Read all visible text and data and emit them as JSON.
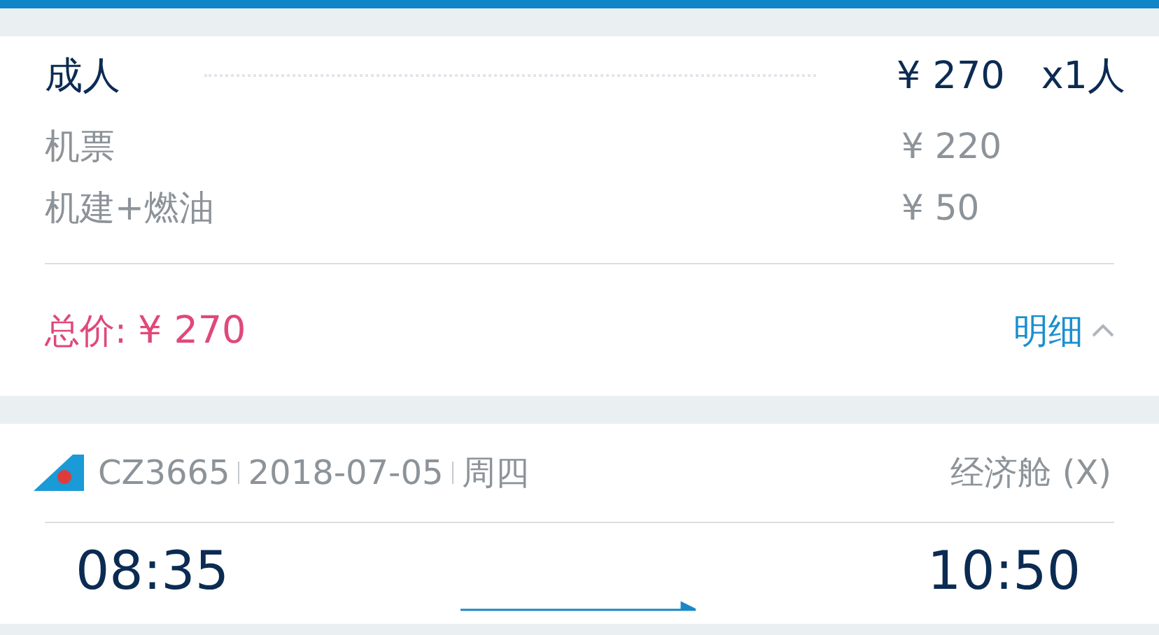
{
  "passenger": {
    "type": "成人",
    "price": "¥ 270",
    "count": "x1人"
  },
  "breakdown": [
    {
      "label": "机票",
      "price": "¥ 220"
    },
    {
      "label": "机建+燃油",
      "price": "¥ 50"
    }
  ],
  "total": {
    "label": "总价:",
    "amount": "¥ 270",
    "details_link": "明细",
    "expanded": true
  },
  "flight": {
    "number": "CZ3665",
    "date": "2018-07-05",
    "weekday": "周四",
    "cabin": "经济舱 (X)",
    "departure_time": "08:35",
    "arrival_time": "10:50"
  }
}
